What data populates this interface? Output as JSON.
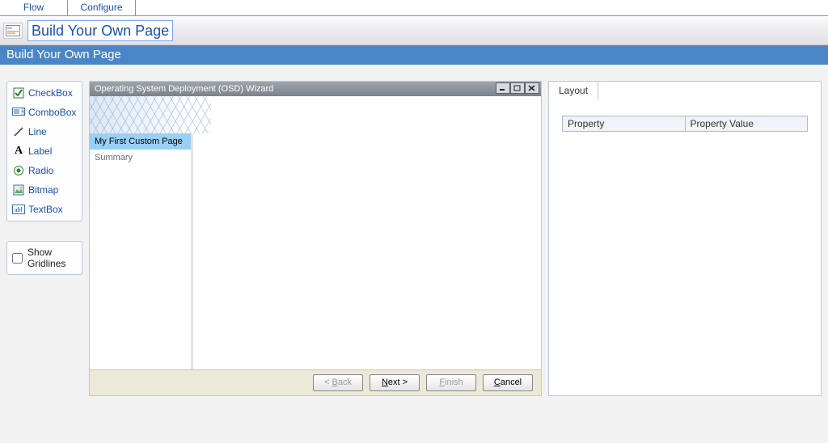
{
  "top_tabs": {
    "flow": "Flow",
    "configure": "Configure"
  },
  "breadcrumb": {
    "title": "Build Your Own Page"
  },
  "page_header": "Build Your Own Page",
  "toolbox": {
    "items": [
      {
        "label": "CheckBox",
        "icon": "checkbox-icon"
      },
      {
        "label": "ComboBox",
        "icon": "combobox-icon"
      },
      {
        "label": "Line",
        "icon": "line-icon"
      },
      {
        "label": "Label",
        "icon": "label-icon"
      },
      {
        "label": "Radio",
        "icon": "radio-icon"
      },
      {
        "label": "Bitmap",
        "icon": "bitmap-icon"
      },
      {
        "label": "TextBox",
        "icon": "textbox-icon"
      }
    ]
  },
  "gridlines": {
    "label": "Show Gridlines",
    "checked": false
  },
  "wizard": {
    "title": "Operating System Deployment (OSD) Wizard",
    "nav": [
      {
        "label": "My First Custom Page",
        "selected": true
      },
      {
        "label": "Summary",
        "selected": false
      }
    ],
    "buttons": {
      "back": "< Back",
      "next": "Next >",
      "finish": "Finish",
      "cancel": "Cancel"
    }
  },
  "properties": {
    "tab_label": "Layout",
    "columns": {
      "name": "Property",
      "value": "Property Value"
    },
    "rows": []
  }
}
